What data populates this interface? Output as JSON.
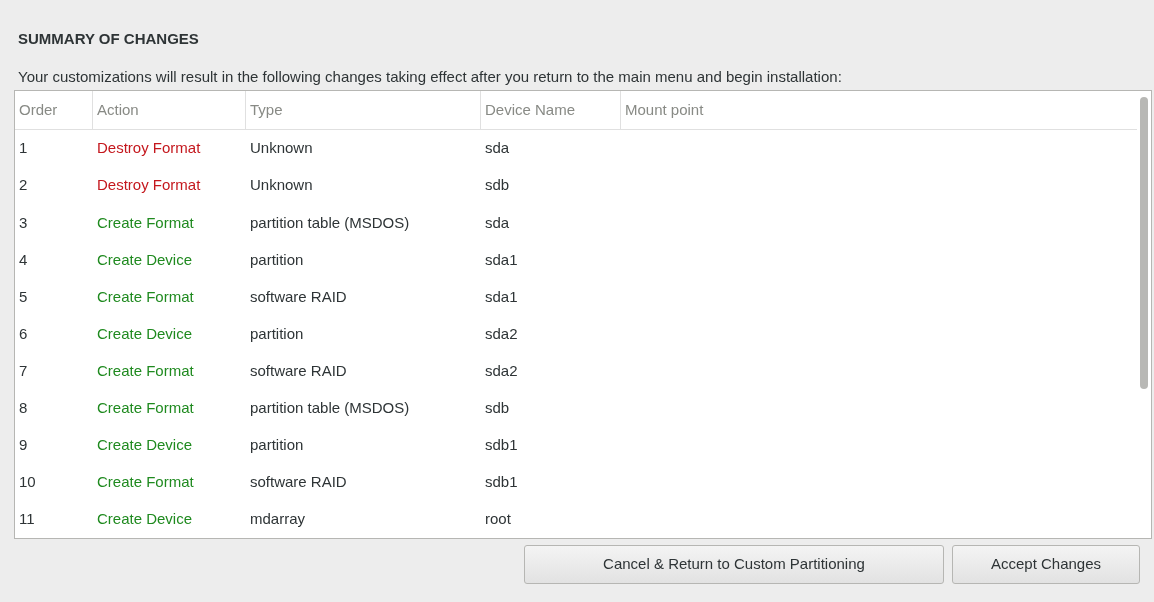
{
  "title": "SUMMARY OF CHANGES",
  "description": "Your customizations will result in the following changes taking effect after you return to the main menu and begin installation:",
  "table": {
    "columns": [
      "Order",
      "Action",
      "Type",
      "Device Name",
      "Mount point"
    ],
    "rows": [
      {
        "order": "1",
        "action": "Destroy Format",
        "kind": "destroy",
        "type": "Unknown",
        "device": "sda"
      },
      {
        "order": "2",
        "action": "Destroy Format",
        "kind": "destroy",
        "type": "Unknown",
        "device": "sdb"
      },
      {
        "order": "3",
        "action": "Create Format",
        "kind": "create",
        "type": "partition table (MSDOS)",
        "device": "sda"
      },
      {
        "order": "4",
        "action": "Create Device",
        "kind": "create",
        "type": "partition",
        "device": "sda1"
      },
      {
        "order": "5",
        "action": "Create Format",
        "kind": "create",
        "type": "software RAID",
        "device": "sda1"
      },
      {
        "order": "6",
        "action": "Create Device",
        "kind": "create",
        "type": "partition",
        "device": "sda2"
      },
      {
        "order": "7",
        "action": "Create Format",
        "kind": "create",
        "type": "software RAID",
        "device": "sda2"
      },
      {
        "order": "8",
        "action": "Create Format",
        "kind": "create",
        "type": "partition table (MSDOS)",
        "device": "sdb"
      },
      {
        "order": "9",
        "action": "Create Device",
        "kind": "create",
        "type": "partition",
        "device": "sdb1"
      },
      {
        "order": "10",
        "action": "Create Format",
        "kind": "create",
        "type": "software RAID",
        "device": "sdb1"
      },
      {
        "order": "11",
        "action": "Create Device",
        "kind": "create",
        "type": "mdarray",
        "device": "root"
      }
    ]
  },
  "buttons": [
    "Cancel & Return to Custom Partitioning",
    "Accept Changes"
  ]
}
